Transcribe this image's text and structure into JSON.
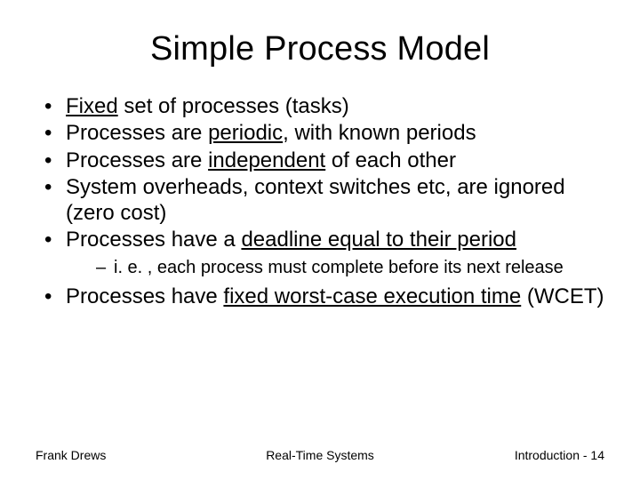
{
  "title": "Simple Process Model",
  "bullets": {
    "b1_pre": "",
    "b1_u": "Fixed",
    "b1_post": " set of processes (tasks)",
    "b2_pre": "Processes are ",
    "b2_u": "periodic",
    "b2_post": ", with known periods",
    "b3_pre": "Processes are ",
    "b3_u": "independent",
    "b3_post": " of each other",
    "b4": "System overheads, context switches etc, are ignored (zero cost)",
    "b5_pre": "Processes have a ",
    "b5_u": "deadline equal to their period",
    "b5_post": "",
    "b5_sub": "i. e. , each process must complete before its next release",
    "b6_pre": "Processes have ",
    "b6_u": "fixed worst-case execution time",
    "b6_post": " (WCET)"
  },
  "footer": {
    "left": "Frank Drews",
    "center": "Real-Time Systems",
    "right": "Introduction - 14"
  }
}
